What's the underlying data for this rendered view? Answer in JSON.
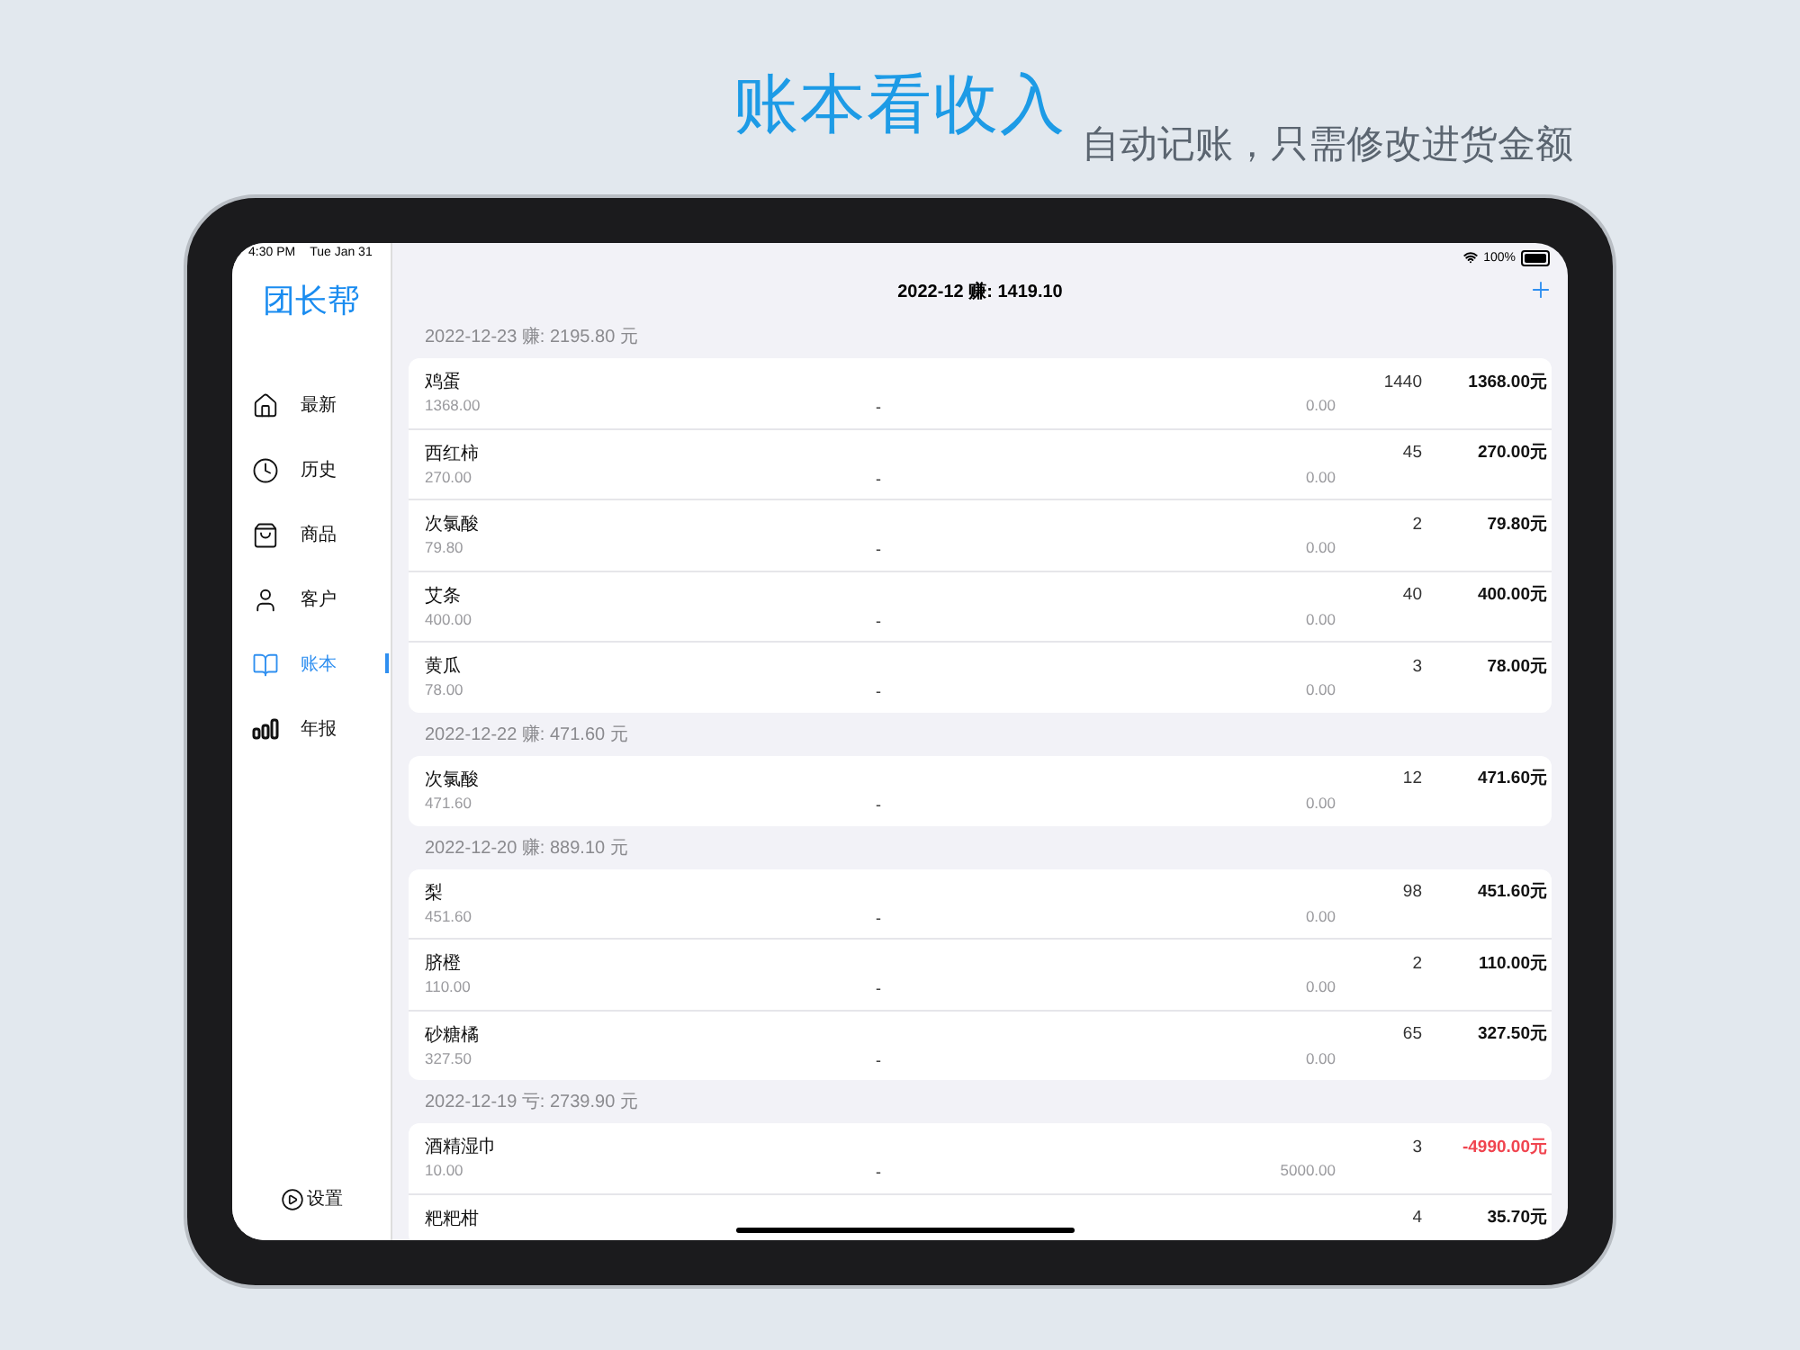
{
  "headline": "账本看收入",
  "subheadline": "自动记账，只需修改进货金额",
  "status_bar": {
    "time": "4:30 PM",
    "date": "Tue Jan 31",
    "battery": "100%"
  },
  "sidebar": {
    "logo": "团长帮",
    "items": [
      {
        "label": "最新",
        "selected": false
      },
      {
        "label": "历史",
        "selected": false
      },
      {
        "label": "商品",
        "selected": false
      },
      {
        "label": "客户",
        "selected": false
      },
      {
        "label": "账本",
        "selected": true
      },
      {
        "label": "年报",
        "selected": false
      }
    ],
    "settings": "设置"
  },
  "nav": {
    "title": "2022-12 赚: 1419.10"
  },
  "sections": [
    {
      "header": "2022-12-23 赚: 2195.80 元",
      "rows": [
        {
          "name": "鸡蛋",
          "price": "1368.00",
          "dash": "-",
          "cost": "0.00",
          "qty": "1440",
          "amount": "1368.00元",
          "negative": false
        },
        {
          "name": "西红柿",
          "price": "270.00",
          "dash": "-",
          "cost": "0.00",
          "qty": "45",
          "amount": "270.00元",
          "negative": false
        },
        {
          "name": "次氯酸",
          "price": "79.80",
          "dash": "-",
          "cost": "0.00",
          "qty": "2",
          "amount": "79.80元",
          "negative": false
        },
        {
          "name": "艾条",
          "price": "400.00",
          "dash": "-",
          "cost": "0.00",
          "qty": "40",
          "amount": "400.00元",
          "negative": false
        },
        {
          "name": "黄瓜",
          "price": "78.00",
          "dash": "-",
          "cost": "0.00",
          "qty": "3",
          "amount": "78.00元",
          "negative": false
        }
      ]
    },
    {
      "header": "2022-12-22 赚: 471.60 元",
      "rows": [
        {
          "name": "次氯酸",
          "price": "471.60",
          "dash": "-",
          "cost": "0.00",
          "qty": "12",
          "amount": "471.60元",
          "negative": false
        }
      ]
    },
    {
      "header": "2022-12-20 赚: 889.10 元",
      "rows": [
        {
          "name": "梨",
          "price": "451.60",
          "dash": "-",
          "cost": "0.00",
          "qty": "98",
          "amount": "451.60元",
          "negative": false
        },
        {
          "name": "脐橙",
          "price": "110.00",
          "dash": "-",
          "cost": "0.00",
          "qty": "2",
          "amount": "110.00元",
          "negative": false
        },
        {
          "name": "砂糖橘",
          "price": "327.50",
          "dash": "-",
          "cost": "0.00",
          "qty": "65",
          "amount": "327.50元",
          "negative": false
        }
      ]
    },
    {
      "header": "2022-12-19 亏: 2739.90 元",
      "rows": [
        {
          "name": "酒精湿巾",
          "price": "10.00",
          "dash": "-",
          "cost": "5000.00",
          "qty": "3",
          "amount": "-4990.00元",
          "negative": true
        },
        {
          "name": "粑粑柑",
          "qty": "4",
          "amount": "35.70元",
          "negative": false
        }
      ]
    }
  ]
}
